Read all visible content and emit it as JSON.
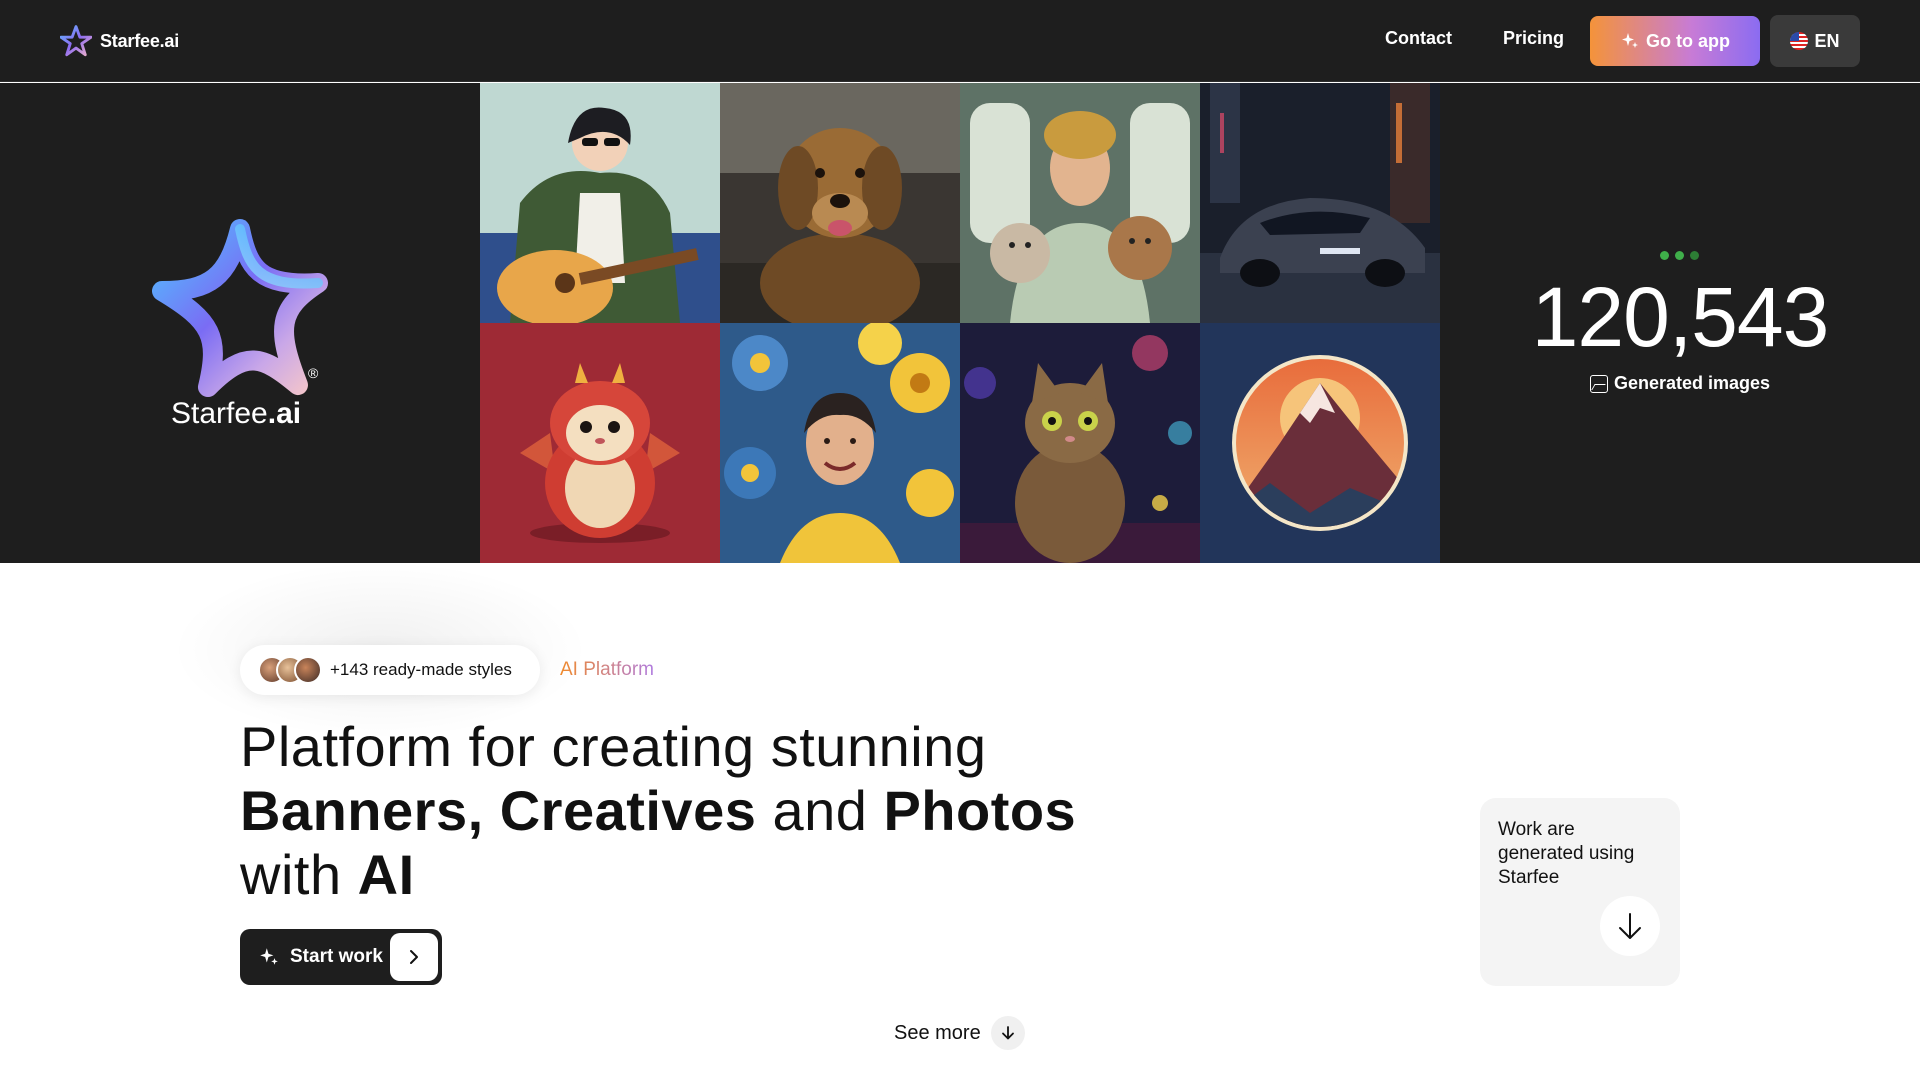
{
  "nav": {
    "brand": "Starfee.ai",
    "links": [
      {
        "label": "Contact"
      },
      {
        "label": "Pricing"
      }
    ],
    "go_to_app": "Go to app",
    "language": "EN"
  },
  "hero": {
    "logo_name": "Starfee",
    "logo_suffix": ".ai",
    "reg_mark": "®",
    "gallery_subjects": [
      "guitar-player-illustration",
      "golden-retriever-photo",
      "woman-with-cats",
      "concept-car-night-city",
      "hamster-dragon-costume",
      "woman-with-yellow-blue-flowers",
      "kitten-neon-bokeh",
      "mountain-sunset-emblem"
    ],
    "generated_count": "120,543",
    "generated_label": "Generated images"
  },
  "intro": {
    "styles_badge": "+143 ready-made styles",
    "tag": "AI Platform",
    "headline": {
      "line1": "Platform for creating stunning",
      "banners": "Banners,",
      "creatives": "Creatives",
      "and": "and",
      "photos": "Photos",
      "with": "with",
      "ai": "AI"
    },
    "start_button": "Start work",
    "see_more": "See more"
  },
  "work_card": {
    "text": "Work are generated using Starfee"
  },
  "colors": {
    "dark_bg": "#1e1e1e",
    "accent_orange": "#f4933a",
    "accent_purple": "#8b6cf1",
    "counter_dot": "#3fae4a"
  }
}
